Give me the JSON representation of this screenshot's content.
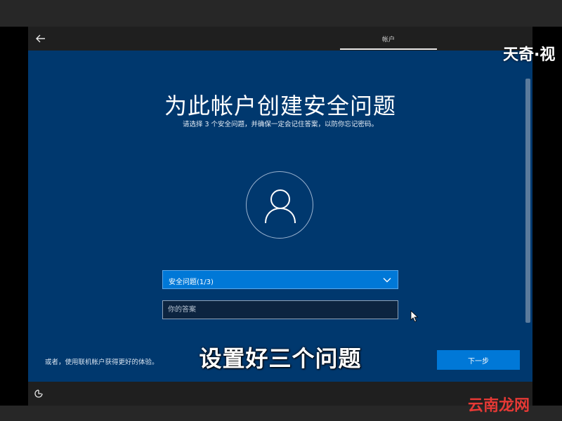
{
  "header": {
    "tab_label": "帐户"
  },
  "page": {
    "title": "为此帐户创建安全问题",
    "subtitle": "请选择 3 个安全问题，并确保一定会记住答案，以防你忘记密码。"
  },
  "form": {
    "question_select_label": "安全问题(1/3)",
    "answer_placeholder": "你的答案"
  },
  "footer": {
    "alt_account_text": "或者，使用联机帐户获得更好的体验。",
    "next_label": "下一步"
  },
  "overlay": {
    "caption": "设置好三个问题",
    "watermark_top": "天奇·视",
    "watermark_bottom": "云南龙网"
  },
  "icons": {
    "back": "back-arrow-icon",
    "avatar": "user-icon",
    "dropdown": "chevron-down-icon",
    "cursor": "mouse-cursor-icon",
    "accessibility": "accessibility-icon"
  },
  "colors": {
    "background": "#00386e",
    "accent": "#0078d7",
    "header": "#1f1f1f"
  }
}
